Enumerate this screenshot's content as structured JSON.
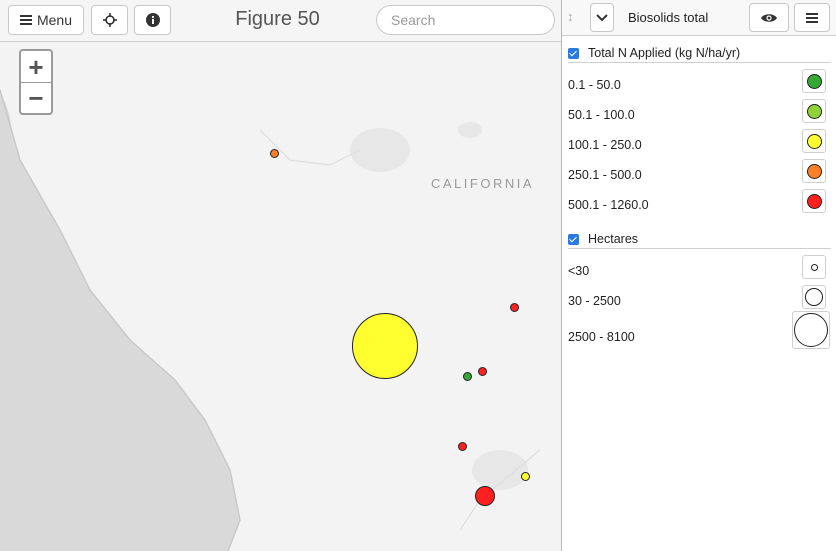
{
  "toolbar": {
    "menu_label": "Menu",
    "locate_icon": "crosshair-icon",
    "info_icon": "info-icon",
    "title": "Figure 50",
    "search_placeholder": "Search"
  },
  "map": {
    "label": "CALIFORNIA",
    "zoom_in": "+",
    "zoom_out": "−",
    "markers": [
      {
        "class": "250.1 - 500.0",
        "color": "#ff7f27",
        "size": "<30"
      },
      {
        "class": "500.1 - 1260.0",
        "color": "#ff2020",
        "size": "<30"
      },
      {
        "class": "100.1 - 250.0",
        "color": "#ffff30",
        "size": "2500 - 8100"
      },
      {
        "class": "0.1 - 50.0",
        "color": "#34a832",
        "size": "<30"
      },
      {
        "class": "500.1 - 1260.0",
        "color": "#ff2020",
        "size": "<30"
      },
      {
        "class": "500.1 - 1260.0",
        "color": "#ff2020",
        "size": "<30"
      },
      {
        "class": "100.1 - 250.0",
        "color": "#ffff30",
        "size": "<30"
      },
      {
        "class": "500.1 - 1260.0",
        "color": "#ff2020",
        "size": "30 - 2500"
      }
    ]
  },
  "legend": {
    "layer_name": "Biosolids total",
    "section_n": "Total N Applied (kg N/ha/yr)",
    "n_classes": [
      {
        "label": "0.1 - 50.0",
        "color": "#34a832"
      },
      {
        "label": "50.1 - 100.0",
        "color": "#8fd23a"
      },
      {
        "label": "100.1 - 250.0",
        "color": "#ffff30"
      },
      {
        "label": "250.1 - 500.0",
        "color": "#ff7f27"
      },
      {
        "label": "500.1 - 1260.0",
        "color": "#ff2020"
      }
    ],
    "section_ha": "Hectares",
    "ha_classes": [
      {
        "label": "<30"
      },
      {
        "label": "30 - 2500"
      },
      {
        "label": "2500 - 8100"
      }
    ]
  }
}
